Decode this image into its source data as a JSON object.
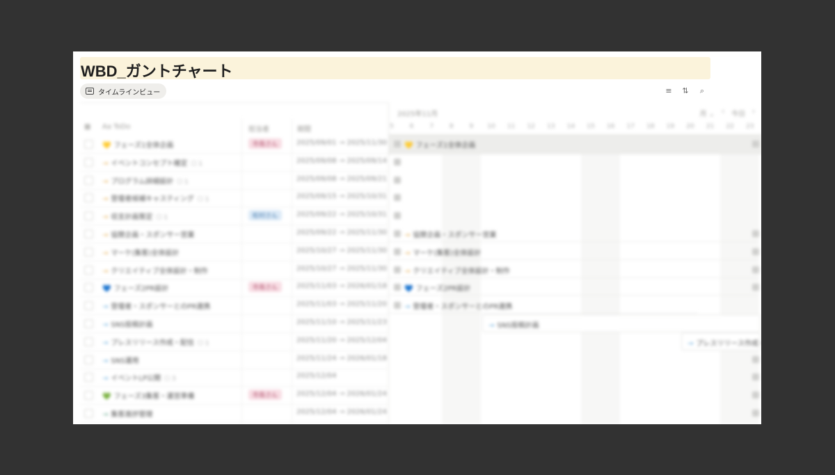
{
  "page": {
    "title": "WBD_ガントチャート",
    "view_label": "タイムラインビュー"
  },
  "icons": {
    "filter": "filter-icon",
    "sort": "sort-icon",
    "search": "search-icon"
  },
  "colors": {
    "title_bg": "#fbf3db",
    "pink_tag": "#f8dde4",
    "blue_tag": "#dceaf7"
  },
  "table": {
    "headers": {
      "name": "Aa ToDo",
      "owner": "担当者",
      "period": "期間"
    },
    "rows": [
      {
        "icon": "💛",
        "name": "フェーズ1全体企画",
        "count": "",
        "owner": "市島さん",
        "owner_color": "pink",
        "period": "2025/09/01 → 2025/11/30"
      },
      {
        "icon": "→",
        "name": "イベントコンセプト確定",
        "count": "☐ 1",
        "owner": "",
        "owner_color": "",
        "period": "2025/09/08 → 2025/09/14"
      },
      {
        "icon": "→",
        "name": "プログラム詳細設計",
        "count": "☐ 1",
        "owner": "",
        "owner_color": "",
        "period": "2025/09/08 → 2025/09/21"
      },
      {
        "icon": "→",
        "name": "登壇者候補キャスティング",
        "count": "☐ 1",
        "owner": "",
        "owner_color": "",
        "period": "2025/09/15 → 2025/10/31"
      },
      {
        "icon": "→",
        "name": "収支計画策定",
        "count": "☐ 1",
        "owner": "松村さん",
        "owner_color": "blue",
        "period": "2025/09/22 → 2025/10/31"
      },
      {
        "icon": "→",
        "name": "協賛企画・スポンサー営業",
        "count": "",
        "owner": "",
        "owner_color": "",
        "period": "2025/09/22 → 2025/11/30"
      },
      {
        "icon": "→",
        "name": "マーケ(集客)全体設計",
        "count": "",
        "owner": "",
        "owner_color": "",
        "period": "2025/10/27 → 2025/11/30"
      },
      {
        "icon": "→",
        "name": "クリエイティブ全体設計・制作",
        "count": "",
        "owner": "",
        "owner_color": "",
        "period": "2025/10/27 → 2025/11/30"
      },
      {
        "icon": "💙",
        "name": "フェーズ2PR設計",
        "count": "",
        "owner": "市島さん",
        "owner_color": "pink",
        "period": "2025/11/03 → 2026/01/18"
      },
      {
        "icon": "→",
        "name": "登壇者・スポンサーとのPR連携",
        "count": "",
        "owner": "",
        "owner_color": "",
        "period": "2025/11/03 → 2025/11/20"
      },
      {
        "icon": "→",
        "name": "SNS投稿計画",
        "count": "",
        "owner": "",
        "owner_color": "",
        "period": "2025/11/10 → 2025/11/23"
      },
      {
        "icon": "→",
        "name": "プレスリリース作成・配信",
        "count": "☐ 1",
        "owner": "",
        "owner_color": "",
        "period": "2025/11/20 → 2025/12/04"
      },
      {
        "icon": "→",
        "name": "SNS運用",
        "count": "",
        "owner": "",
        "owner_color": "",
        "period": "2025/11/24 → 2026/01/18"
      },
      {
        "icon": "→",
        "name": "イベントLP公開",
        "count": "☐ 3",
        "owner": "",
        "owner_color": "",
        "period": "2025/12/04"
      },
      {
        "icon": "💚",
        "name": "フェーズ3集客・運営準備",
        "count": "",
        "owner": "市島さん",
        "owner_color": "pink",
        "period": "2025/12/04 → 2026/01/24"
      },
      {
        "icon": "→",
        "name": "集客進捗管理",
        "count": "",
        "owner": "",
        "owner_color": "",
        "period": "2025/12/04 → 2026/01/24"
      }
    ]
  },
  "timeline": {
    "month": "2025年11月",
    "scale": "月 ⌄",
    "today": "今日",
    "prev": "‹",
    "next": "›",
    "days": [
      "5",
      "6",
      "7",
      "8",
      "9",
      "10",
      "11",
      "12",
      "13",
      "14",
      "15",
      "16",
      "17",
      "18",
      "19",
      "20",
      "21",
      "22",
      "23"
    ],
    "bars": [
      {
        "icon": "💛",
        "label": "フェーズ1全体企画"
      },
      {
        "icon": "→",
        "label": "協賛企画・スポンサー営業"
      },
      {
        "icon": "→",
        "label": "マーケ(集客)全体設計"
      },
      {
        "icon": "→",
        "label": "クリエイティブ全体設計・制作"
      },
      {
        "icon": "💙",
        "label": "フェーズ2PR設計"
      },
      {
        "icon": "→",
        "label": "登壇者・スポンサーとのPR連携"
      },
      {
        "icon": "→",
        "label": "SNS投稿計画"
      },
      {
        "icon": "→",
        "label": "プレスリリース作成・配信"
      }
    ]
  }
}
